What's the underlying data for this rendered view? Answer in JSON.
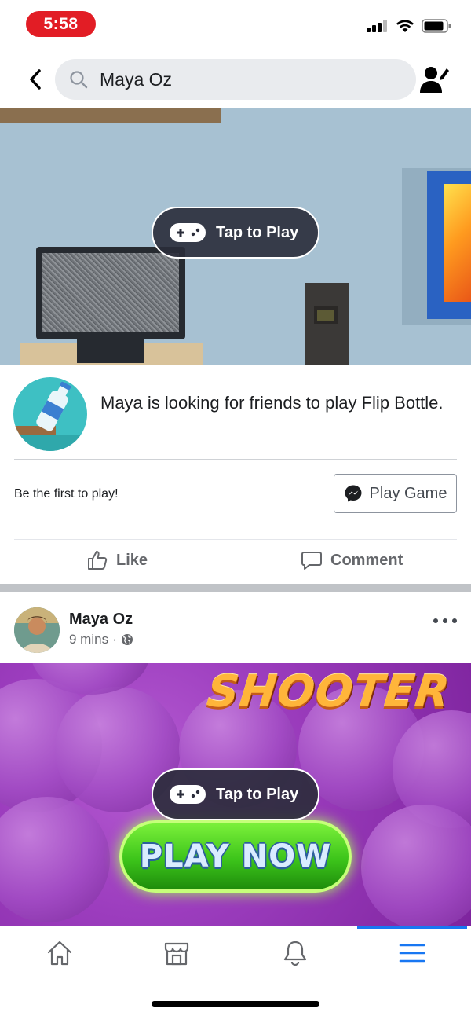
{
  "status_bar": {
    "time": "5:58",
    "icons": [
      "signal-icon",
      "wifi-icon",
      "battery-icon"
    ]
  },
  "search": {
    "query": "Maya Oz",
    "icons": [
      "back-arrow-icon",
      "search-icon",
      "profile-edit-icon"
    ]
  },
  "game_card": {
    "tap_to_play": "Tap to Play",
    "invite_text": "Maya is looking for friends to play Flip Bottle.",
    "first_play_text": "Be the first to play!",
    "play_game_label": "Play Game",
    "like_label": "Like",
    "comment_label": "Comment"
  },
  "post": {
    "author": "Maya Oz",
    "time": "9 mins",
    "separator": "·",
    "privacy_icon": "globe-icon",
    "game_title_art": "SHOOTER",
    "play_now_label": "PLAY NOW",
    "tap_to_play": "Tap to Play"
  },
  "bottom_nav": {
    "items": [
      "home-icon",
      "marketplace-icon",
      "notifications-icon",
      "menu-icon"
    ],
    "active": "menu-icon"
  },
  "colors": {
    "time_pill": "#e21d25",
    "accent": "#1877f2",
    "search_bg": "#e9ebee",
    "game_banner_1": "#a7c1d2",
    "game_banner_2": "#9c3dbe"
  }
}
